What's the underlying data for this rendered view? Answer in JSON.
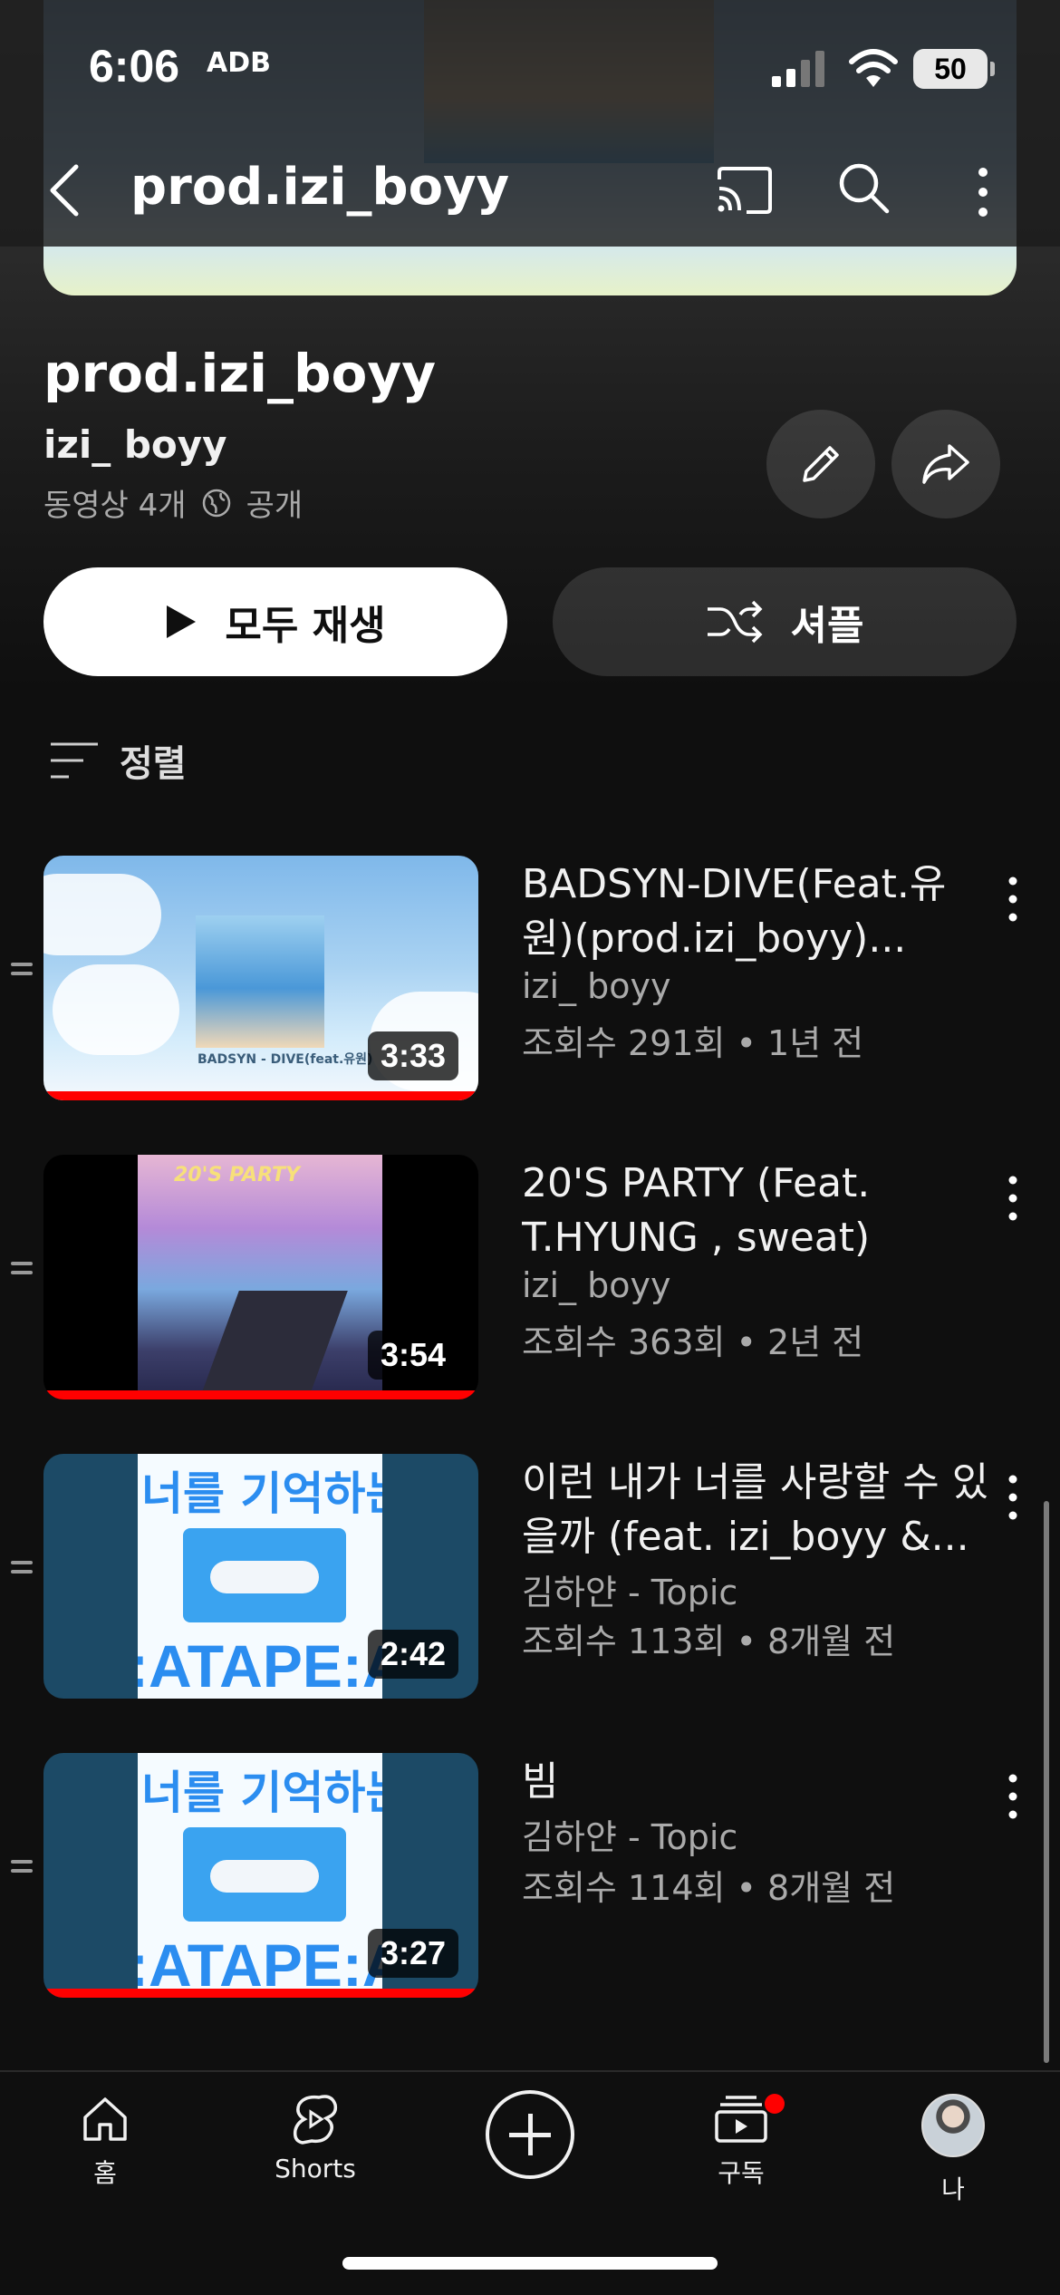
{
  "status_bar": {
    "time": "6:06",
    "app_label": "ADB",
    "battery": "50"
  },
  "app_bar": {
    "title": "prod.izi_boyy"
  },
  "playlist": {
    "title": "prod.izi_boyy",
    "owner": "izi_ boyy",
    "video_count": "동영상 4개",
    "visibility": "공개"
  },
  "actions": {
    "play_all": "모두 재생",
    "shuffle": "셔플",
    "sort": "정렬"
  },
  "videos": [
    {
      "title": "BADSYN-DIVE(Feat.유원)(prod.izi_boyy)...",
      "channel": "izi_ boyy",
      "stats": "조회수 291회 • 1년 전",
      "duration": "3:33",
      "thumb_caption": "BADSYN - DIVE(feat.유원)",
      "progress": 1.0
    },
    {
      "title": "20'S PARTY (Feat. T.HYUNG , sweat)",
      "channel": "izi_ boyy",
      "stats": "조회수 363회 • 2년 전",
      "duration": "3:54",
      "thumb_caption": "20'S PARTY",
      "progress": 1.0
    },
    {
      "title": "이런 내가 너를 사랑할 수 있을까 (feat. izi_boyy &...",
      "channel": "김하얀 - Topic",
      "stats": "조회수 113회 • 8개월 전",
      "duration": "2:42",
      "thumb_caption_top": "너를 기억하는 방식",
      "thumb_caption_bottom": ":ATAPE:A",
      "progress": 0
    },
    {
      "title": "빔",
      "channel": "김하얀 - Topic",
      "stats": "조회수 114회 • 8개월 전",
      "duration": "3:27",
      "thumb_caption_top": "너를 기억하는 방식",
      "thumb_caption_bottom": ":ATAPE:A",
      "progress": 1.0
    }
  ],
  "bottom_nav": {
    "home": "홈",
    "shorts": "Shorts",
    "subscriptions": "구독",
    "me": "나"
  },
  "colors": {
    "accent": "#ff0000",
    "background": "#0f0f0f"
  }
}
